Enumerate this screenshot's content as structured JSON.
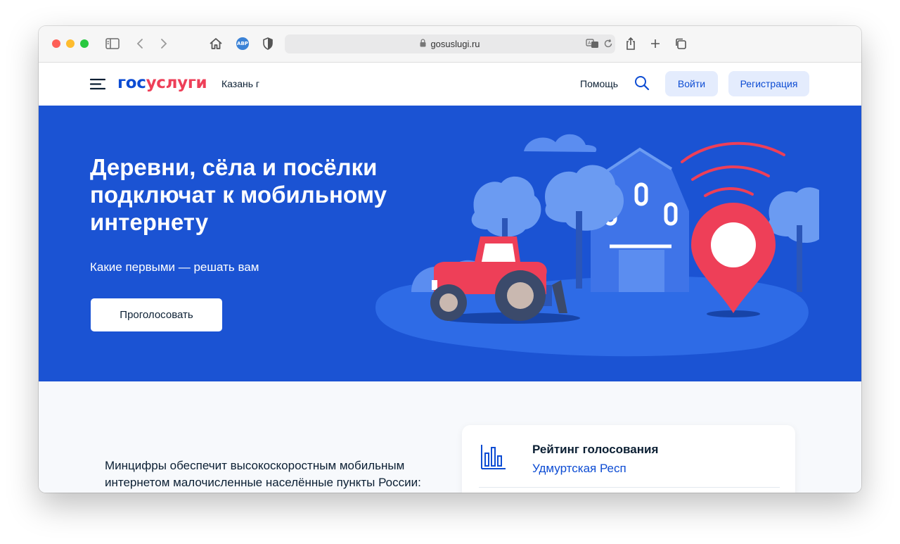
{
  "browser": {
    "url": "gosuslugi.ru",
    "abp_label": "ABP"
  },
  "header": {
    "logo_part1": "гос",
    "logo_part2": "услуги",
    "city": "Казань г",
    "help": "Помощь",
    "login": "Войти",
    "register": "Регистрация"
  },
  "hero": {
    "title": "Деревни, сёла и посёлки подключат к мобильному интернету",
    "subtitle": "Какие первыми — решать вам",
    "button": "Проголосовать"
  },
  "content": {
    "text": "Минцифры обеспечит высокоскоростным мобильным интернетом малочисленные населённые пункты России:",
    "rating_title": "Рейтинг голосования",
    "rating_region": "Удмуртская Респ"
  },
  "colors": {
    "brand_blue": "#0d4cd3",
    "brand_red": "#ee3f58",
    "hero_bg": "#1b53d3"
  }
}
